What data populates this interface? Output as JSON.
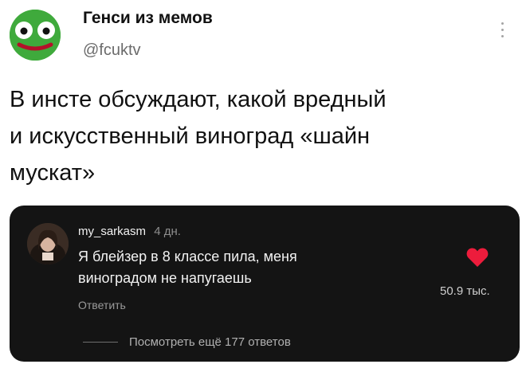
{
  "tweet": {
    "author_name": "Генси из мемов",
    "author_handle": "@fcuktv",
    "text_lines": [
      "В инсте обсуждают, какой вредный",
      "и искусственный виноград «шайн",
      "мускат»"
    ]
  },
  "comment": {
    "username": "my_sarkasm",
    "age": "4 дн.",
    "text_lines": [
      "Я блейзер в 8 классе пила, меня",
      "виноградом не напугаешь"
    ],
    "reply_label": "Ответить",
    "likes": "50.9 тыс.",
    "view_replies": "Посмотреть ещё 177 ответов"
  },
  "colors": {
    "card_background": "#141414",
    "heart": "#ed1c3c",
    "avatar_green": "#3faa3c"
  },
  "icons": [
    "frog-avatar-icon",
    "more-icon",
    "heart-icon",
    "commenter-avatar"
  ]
}
